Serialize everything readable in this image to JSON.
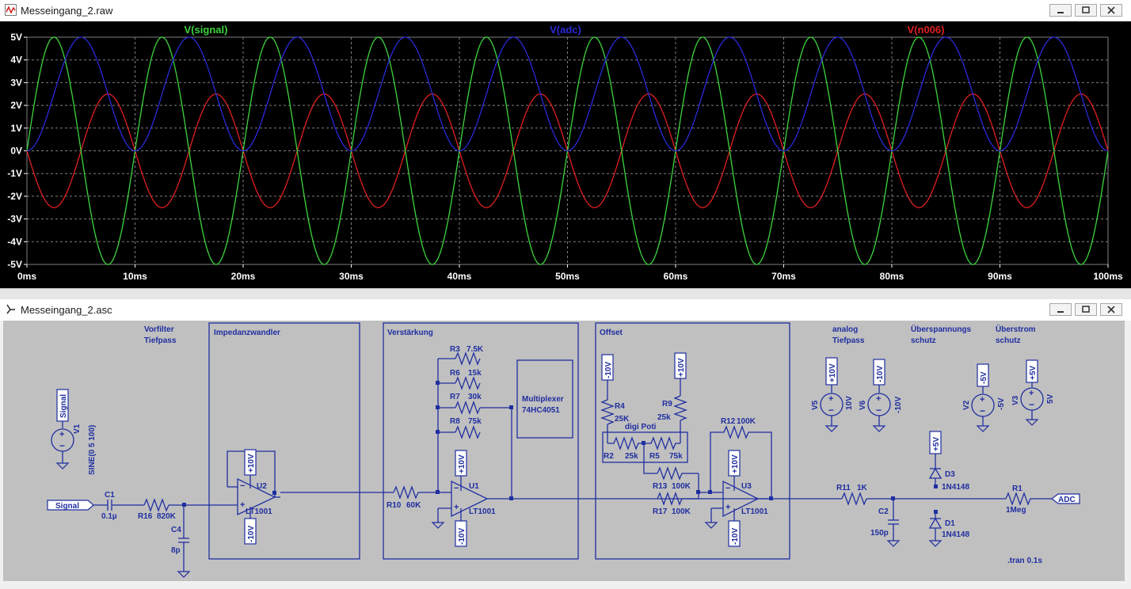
{
  "waveform_window": {
    "title": "Messeingang_2.raw",
    "traces": [
      {
        "name": "V(signal)",
        "color": "#3cd43c",
        "amplitude": 5,
        "offset": 0,
        "frequency_hz": 100,
        "phase": "sin"
      },
      {
        "name": "V(adc)",
        "color": "#2a2ad8",
        "amplitude": 2.5,
        "offset": 2.5,
        "frequency_hz": 100,
        "phase": "-cos"
      },
      {
        "name": "V(n006)",
        "color": "#e02020",
        "amplitude": 2.5,
        "offset": 0,
        "frequency_hz": 100,
        "phase": "-sin"
      }
    ],
    "y_ticks": [
      "5V",
      "4V",
      "3V",
      "2V",
      "1V",
      "0V",
      "-1V",
      "-2V",
      "-3V",
      "-4V",
      "-5V"
    ],
    "x_ticks": [
      "0ms",
      "10ms",
      "20ms",
      "30ms",
      "40ms",
      "50ms",
      "60ms",
      "70ms",
      "80ms",
      "90ms",
      "100ms"
    ],
    "chart_data": {
      "type": "line",
      "x_range_ms": [
        0,
        100
      ],
      "ylim": [
        -5,
        5
      ],
      "grid": true,
      "series": [
        {
          "name": "V(signal)",
          "function": "5*sin(2*pi*100*t)"
        },
        {
          "name": "V(adc)",
          "function": "2.5-2.5*cos(2*pi*100*t)"
        },
        {
          "name": "V(n006)",
          "function": "-2.5*sin(2*pi*100*t)"
        }
      ]
    }
  },
  "schematic_window": {
    "title": "Messeingang_2.asc",
    "blocks": {
      "vorfilter": "Vorfilter",
      "tiefpass": "Tiefpass",
      "impedanz": "Impedanzwandler",
      "verstaerkung": "Verstärkung",
      "offset": "Offset",
      "analog": "analog",
      "analog_tiefpass": "Tiefpass",
      "ueberspannung": "Überspannungs",
      "ueberspannung_schutz": "schutz",
      "ueberstrom": "Überstrom",
      "ueberstrom_schutz": "schutz",
      "multiplexer": "Multiplexer",
      "multiplexer_part": "74HC4051",
      "digi_poti": "digi Poti"
    },
    "nets": {
      "signal": "Signal",
      "adc": "ADC",
      "p10": "+10V",
      "m10": "-10V",
      "p5": "+5V",
      "m5": "-5V"
    },
    "components": {
      "V1": "V1",
      "V1_value": "SINE(0 5 100)",
      "C1": "C1",
      "C1_value": "0.1µ",
      "R16": "R16",
      "R16_value": "820K",
      "C4": "C4",
      "C4_value": "8p",
      "U2": "U2",
      "U2_part": "LT1001",
      "R10": "R10",
      "R10_value": "60K",
      "U1": "U1",
      "U1_part": "LT1001",
      "R3": "R3",
      "R3_value": "7.5K",
      "R6": "R6",
      "R6_value": "15k",
      "R7": "R7",
      "R7_value": "30k",
      "R8": "R8",
      "R8_value": "75k",
      "R4": "R4",
      "R4_value": "25K",
      "R9": "R9",
      "R9_value": "25k",
      "R2": "R2",
      "R2_value": "25k",
      "R5": "R5",
      "R5_value": "75k",
      "R12": "R12",
      "R12_value": "100K",
      "R13": "R13",
      "R13_value": "100K",
      "R17": "R17",
      "R17_value": "100K",
      "U3": "U3",
      "U3_part": "LT1001",
      "V5": "V5",
      "V5_value": "10V",
      "V6": "V6",
      "V6_value": "-10V",
      "V2": "V2",
      "V2_value": "-5V",
      "V3": "V3",
      "V3_value": "5V",
      "R11": "R11",
      "R11_value": "1K",
      "C2": "C2",
      "C2_value": "150p",
      "D3": "D3",
      "D3_part": "1N4148",
      "D1": "D1",
      "D1_part": "1N4148",
      "R1": "R1",
      "R1_value": "1Meg"
    },
    "directive": ".tran 0.1s"
  }
}
